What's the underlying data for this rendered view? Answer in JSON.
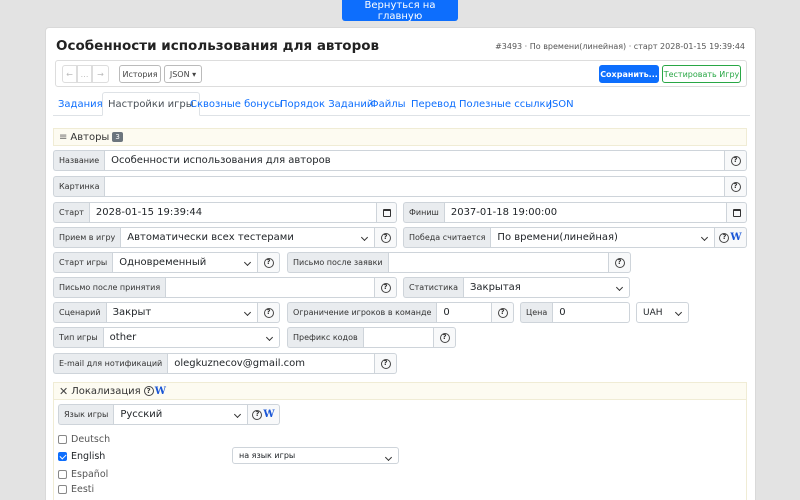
{
  "header": {
    "back_label": "Вернуться на главную"
  },
  "page": {
    "title": "Особенности использования для авторов",
    "meta": "#3493 · По времени(линейная) · старт 2028-01-15 19:39:44"
  },
  "toolbar": {
    "undo": "←",
    "mid": "…",
    "redo": "→",
    "history": "История",
    "json": "JSON ▾",
    "save": "Сохранить...",
    "test": "Тестировать Игру"
  },
  "tabs": [
    "Задания",
    "Настройки игры",
    "Сквозные бонусы",
    "Порядок Заданий",
    "Файлы",
    "Перевод",
    "Полезные ссылки",
    "JSON"
  ],
  "authors": {
    "label": "Авторы",
    "count": "3"
  },
  "form": {
    "name": {
      "label": "Название",
      "value": "Особенности использования для авторов"
    },
    "image": {
      "label": "Картинка",
      "value": ""
    },
    "start": {
      "label": "Старт",
      "value": "2028-01-15 19:39:44"
    },
    "finish": {
      "label": "Финиш",
      "value": "2037-01-18 19:00:00"
    },
    "accept": {
      "label": "Прием в игру",
      "value": "Автоматически всех тестерами"
    },
    "victory": {
      "label": "Победа считается",
      "value": "По времени(линейная)"
    },
    "game_start": {
      "label": "Старт игры",
      "value": "Одновременный"
    },
    "letter_after_apply": {
      "label": "Письмо после заявки",
      "value": ""
    },
    "letter_after_accept": {
      "label": "Письмо после принятия",
      "value": ""
    },
    "stats": {
      "label": "Статистика",
      "value": "Закрытая"
    },
    "scenario": {
      "label": "Сценарий",
      "value": "Закрыт"
    },
    "team_limit": {
      "label": "Ограничение игроков в команде",
      "value": "0"
    },
    "price": {
      "label": "Цена",
      "value": "0"
    },
    "currency": "UAH",
    "game_type": {
      "label": "Тип игры",
      "value": "other"
    },
    "code_prefix": {
      "label": "Префикс кодов",
      "value": ""
    },
    "email": {
      "label": "E-mail для нотификаций",
      "value": "olegkuznecov@gmail.com"
    }
  },
  "localization": {
    "label": "Локализация",
    "lang_label": "Язык игры",
    "lang_value": "Русский",
    "languages": [
      {
        "name": "Deutsch",
        "checked": false
      },
      {
        "name": "English",
        "checked": true
      },
      {
        "name": "Español",
        "checked": false
      },
      {
        "name": "Eesti",
        "checked": false
      }
    ],
    "english_select": "на язык игры"
  },
  "colors": {
    "primary": "#0d6efd",
    "success": "#28a745",
    "section_bg": "#fdfbf1"
  }
}
